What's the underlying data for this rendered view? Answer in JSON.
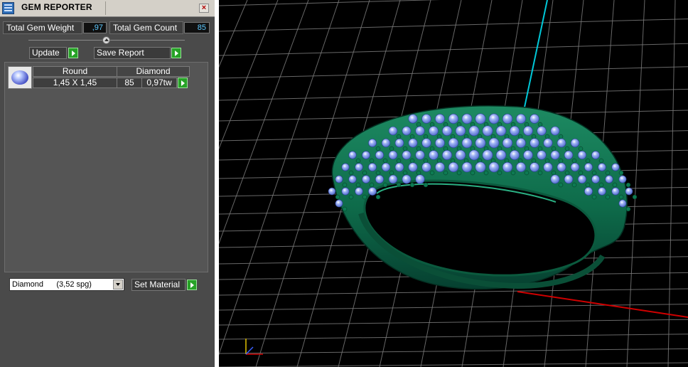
{
  "window": {
    "title": "GEM REPORTER",
    "close_label": "×"
  },
  "stats": {
    "total_weight_label": "Total Gem Weight",
    "total_weight_value": ",97",
    "total_count_label": "Total Gem Count",
    "total_count_value": "85"
  },
  "toolbar": {
    "update_label": "Update",
    "save_label": "Save Report"
  },
  "gem_table": {
    "headers": [
      "Round",
      "Diamond"
    ],
    "rows": [
      {
        "size": "1,45 X 1,45",
        "count": "85",
        "weight": "0,97tw"
      }
    ]
  },
  "material": {
    "selected": "Diamond      (3,52 spg)",
    "set_label": "Set Material"
  },
  "icons": {
    "app": "gem-reporter-icon",
    "close": "close-icon",
    "collapse": "collapse-icon",
    "run": "play-arrow-icon",
    "dropdown": "chevron-down-icon",
    "axis": "axis-gizmo-icon"
  },
  "colors": {
    "panel_bg": "#4a4a4a",
    "value_text": "#5ec9ff",
    "run_button": "#27a227",
    "metal": "#0e6b4a",
    "gem": "#9fb4f5",
    "grid": "#7a7a7a",
    "y_axis": "#00c8d8",
    "x_axis": "#d00000"
  }
}
